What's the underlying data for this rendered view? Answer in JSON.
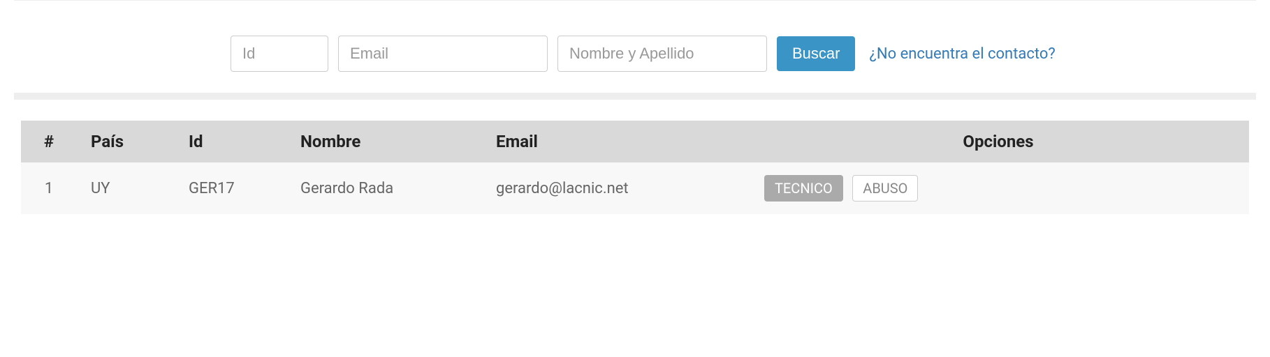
{
  "search": {
    "id_placeholder": "Id",
    "email_placeholder": "Email",
    "name_placeholder": "Nombre y Apellido",
    "button_label": "Buscar",
    "help_link": "¿No encuentra el contacto?"
  },
  "table": {
    "headers": {
      "num": "#",
      "country": "País",
      "id": "Id",
      "name": "Nombre",
      "email": "Email",
      "options": "Opciones"
    },
    "rows": [
      {
        "num": "1",
        "country": "UY",
        "id": "GER17",
        "name": "Gerardo Rada",
        "email": "gerardo@lacnic.net",
        "options": {
          "tecnico": "TECNICO",
          "abuso": "ABUSO"
        }
      }
    ]
  }
}
